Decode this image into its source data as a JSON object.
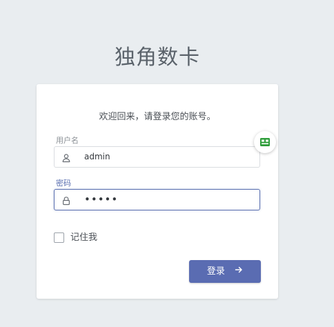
{
  "app": {
    "title": "独角数卡"
  },
  "login": {
    "welcome": "欢迎回来，请登录您的账号。",
    "username": {
      "label": "用户名",
      "value": "admin",
      "icon": "user-icon"
    },
    "password": {
      "label": "密码",
      "value": "•••••",
      "icon": "lock-icon"
    },
    "remember_label": "记住我",
    "remember_checked": false,
    "submit_label": "登录",
    "submit_icon": "arrow-right-icon"
  },
  "colors": {
    "background": "#e9edf0",
    "primary": "#5a6cb2",
    "focus_border": "#5a6fb0",
    "extension": "#2e9d3a"
  },
  "extension_badge": {
    "icon": "password-manager-icon"
  }
}
